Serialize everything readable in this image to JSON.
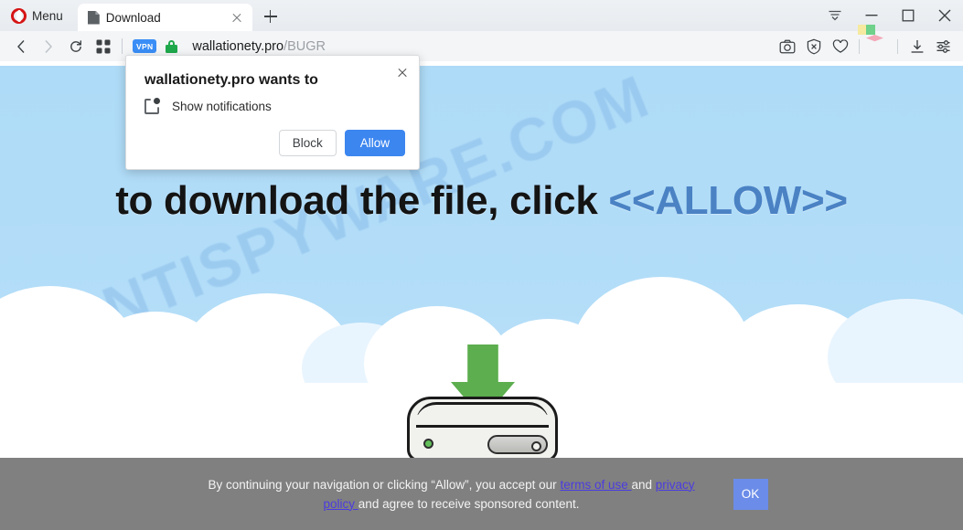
{
  "browser": {
    "menu_label": "Menu",
    "tab": {
      "title": "Download",
      "favicon": "page-icon",
      "close": "close-icon"
    },
    "new_tab": "plus-icon",
    "window_controls": [
      "tab-list-icon",
      "minimize-icon",
      "maximize-icon",
      "close-icon"
    ],
    "nav": {
      "back": "back-arrow-icon",
      "forward": "forward-arrow-icon",
      "reload": "reload-icon",
      "grid": "speed-dial-grid-icon"
    },
    "address": {
      "vpn_badge": "VPN",
      "security": "lock-icon",
      "host": "wallationety.pro",
      "path": "/BUGR"
    },
    "right_icons": [
      "snapshot-camera-icon",
      "ad-blocker-icon",
      "heart-icon",
      "workspaces-cube-icon",
      "downloads-icon",
      "easy-setup-icon"
    ]
  },
  "dialog": {
    "title": "wallationety.pro wants to",
    "permission_label": "Show notifications",
    "permission_icon": "notification-icon",
    "close_icon": "close-icon",
    "block_label": "Block",
    "allow_label": "Allow"
  },
  "page": {
    "headline_prefix": "to download the file, click ",
    "headline_accent": "<<ALLOW>>",
    "watermark": "MYANTISPYWARE.COM",
    "illustration": "hard-drive-download-icon",
    "colors": {
      "sky": "#aedbf7",
      "accent_blue": "#4a82c4",
      "arrow_green": "#5cae4e",
      "banner_gray": "#808080",
      "ok_blue": "#6b8ce8",
      "link_purple": "#4b3ce0",
      "allow_button_blue": "#3c86f0",
      "vpn_blue": "#3a8ef6"
    }
  },
  "cookie_banner": {
    "text_part1": "By continuing your navigation or clicking “Allow”, you accept our ",
    "link_terms": "terms of use ",
    "text_and": "and ",
    "link_privacy": "privacy policy ",
    "text_part2": "and agree to receive sponsored content.",
    "ok_label": "OK"
  }
}
